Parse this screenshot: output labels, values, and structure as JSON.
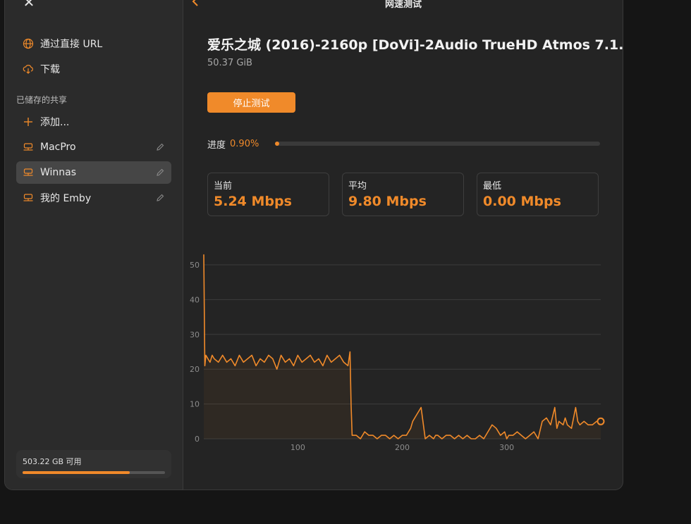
{
  "sidebar": {
    "items": [
      {
        "label": "通过直接 URL",
        "icon": "globe-icon"
      },
      {
        "label": "下载",
        "icon": "cloud-download-icon"
      }
    ],
    "saved_header": "已储存的共享",
    "add_label": "添加...",
    "shares": [
      {
        "label": "MacPro",
        "selected": false
      },
      {
        "label": "Winnas",
        "selected": true
      },
      {
        "label": "我的 Emby",
        "selected": false
      }
    ],
    "storage": {
      "text": "503.22 GB 可用",
      "used_fraction": 0.75
    }
  },
  "main": {
    "title": "网速测试",
    "file_title": "爱乐之城 (2016)-2160p [DoVi]-2Audio TrueHD Atmos 7.1.mkv",
    "file_size": "50.37 GiB",
    "stop_button": "停止测试",
    "progress_label": "进度",
    "progress_value": "0.90%",
    "progress_fraction": 0.009,
    "stats": [
      {
        "label": "当前",
        "value": "5.24 Mbps"
      },
      {
        "label": "平均",
        "value": "9.80 Mbps"
      },
      {
        "label": "最低",
        "value": "0.00 Mbps"
      }
    ]
  },
  "colors": {
    "accent": "#f08a2a"
  },
  "chart_data": {
    "type": "line",
    "xlim": [
      10,
      390
    ],
    "ylim": [
      0,
      50
    ],
    "x_ticks": [
      100,
      200,
      300
    ],
    "y_ticks": [
      0,
      10,
      20,
      30,
      40,
      50
    ],
    "grid": true,
    "series": [
      {
        "x": [
          10,
          11,
          12,
          14,
          16,
          18,
          20,
          24,
          28,
          32,
          36,
          40,
          44,
          48,
          52,
          56,
          60,
          64,
          68,
          72,
          76,
          80,
          84,
          88,
          92,
          96,
          100,
          104,
          108,
          112,
          116,
          120,
          124,
          128,
          132,
          136,
          140,
          144,
          148,
          150,
          151,
          152,
          156,
          160,
          164,
          168,
          172,
          176,
          180,
          184,
          188,
          192,
          196,
          200,
          204,
          208,
          210,
          214,
          218,
          222,
          226,
          230,
          232,
          234,
          238,
          242,
          246,
          250,
          254,
          258,
          262,
          266,
          270,
          274,
          278,
          282,
          286,
          290,
          294,
          298,
          300,
          302,
          306,
          310,
          314,
          318,
          322,
          326,
          330,
          334,
          338,
          342,
          346,
          348,
          350,
          354,
          356,
          358,
          362,
          366,
          368,
          370,
          374,
          378,
          382,
          386,
          390
        ],
        "y": [
          53,
          21,
          24,
          23,
          22,
          24,
          23,
          22,
          24,
          22,
          23,
          21,
          24,
          22,
          23,
          24,
          21,
          23,
          22,
          24,
          23,
          20,
          24,
          22,
          23,
          21,
          24,
          22,
          23,
          24,
          22,
          23,
          21,
          24,
          22,
          23,
          24,
          22,
          21,
          25,
          10,
          1,
          1,
          0,
          2,
          1,
          1,
          0,
          1,
          1,
          0,
          1,
          0,
          1,
          1,
          3,
          5,
          7,
          9,
          0,
          1,
          0,
          1,
          1,
          0,
          1,
          1,
          0,
          1,
          0,
          1,
          0,
          0,
          1,
          0,
          2,
          4,
          3,
          1,
          2,
          0,
          1,
          1,
          2,
          1,
          0,
          1,
          2,
          0,
          5,
          6,
          4,
          9,
          3,
          5,
          4,
          6,
          4,
          3,
          9,
          5,
          4,
          5,
          4,
          4,
          5,
          5
        ]
      }
    ]
  }
}
